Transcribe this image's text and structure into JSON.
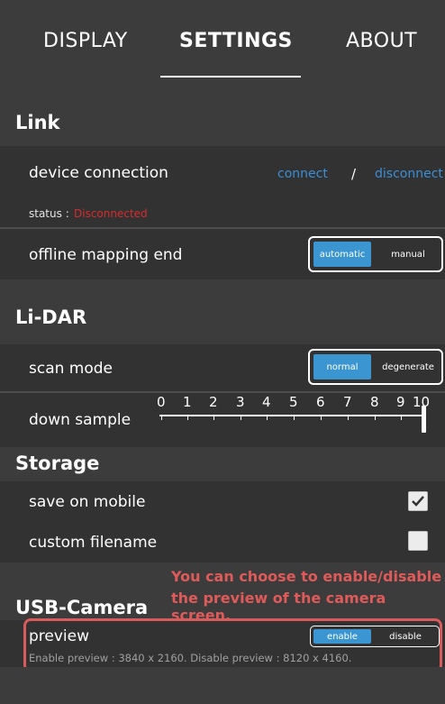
{
  "tabs": [
    {
      "label": "DISPLAY"
    },
    {
      "label": "SETTINGS"
    },
    {
      "label": "ABOUT"
    }
  ],
  "link": {
    "title": "Link",
    "device_connection": "device connection",
    "connect": "connect",
    "slash": "/",
    "disconnect": "disconnect",
    "status_label": "status :",
    "status_value": "Disconnected",
    "offline_mapping": "offline mapping end",
    "offline_options": [
      "automatic",
      "manual"
    ],
    "offline_selected": "automatic"
  },
  "lidar": {
    "title": "Li-DAR",
    "scan_mode": "scan mode",
    "scan_options": [
      "normal",
      "degenerate"
    ],
    "scan_selected": "normal",
    "down_sample": "down sample",
    "slider_ticks": [
      "0",
      "1",
      "2",
      "3",
      "4",
      "5",
      "6",
      "7",
      "8",
      "9",
      "10"
    ],
    "slider_value": 10
  },
  "storage": {
    "title": "Storage",
    "save_on_mobile": "save on mobile",
    "save_on_mobile_checked": true,
    "custom_filename": "custom filename",
    "custom_filename_checked": false
  },
  "usb_camera": {
    "title": "USB-Camera",
    "preview": "preview",
    "preview_options": [
      "enable",
      "disable"
    ],
    "preview_selected": "enable",
    "note": "Enable preview : 3840 x 2160. Disable preview : 8120 x 4160."
  },
  "annotation": {
    "line1": "You can choose to enable/disable",
    "line2": "the preview of the camera screen."
  },
  "colors": {
    "accent": "#3a95d1",
    "link": "#3a8fd8",
    "error": "#d72b2b",
    "annotation": "#e05a5a"
  }
}
